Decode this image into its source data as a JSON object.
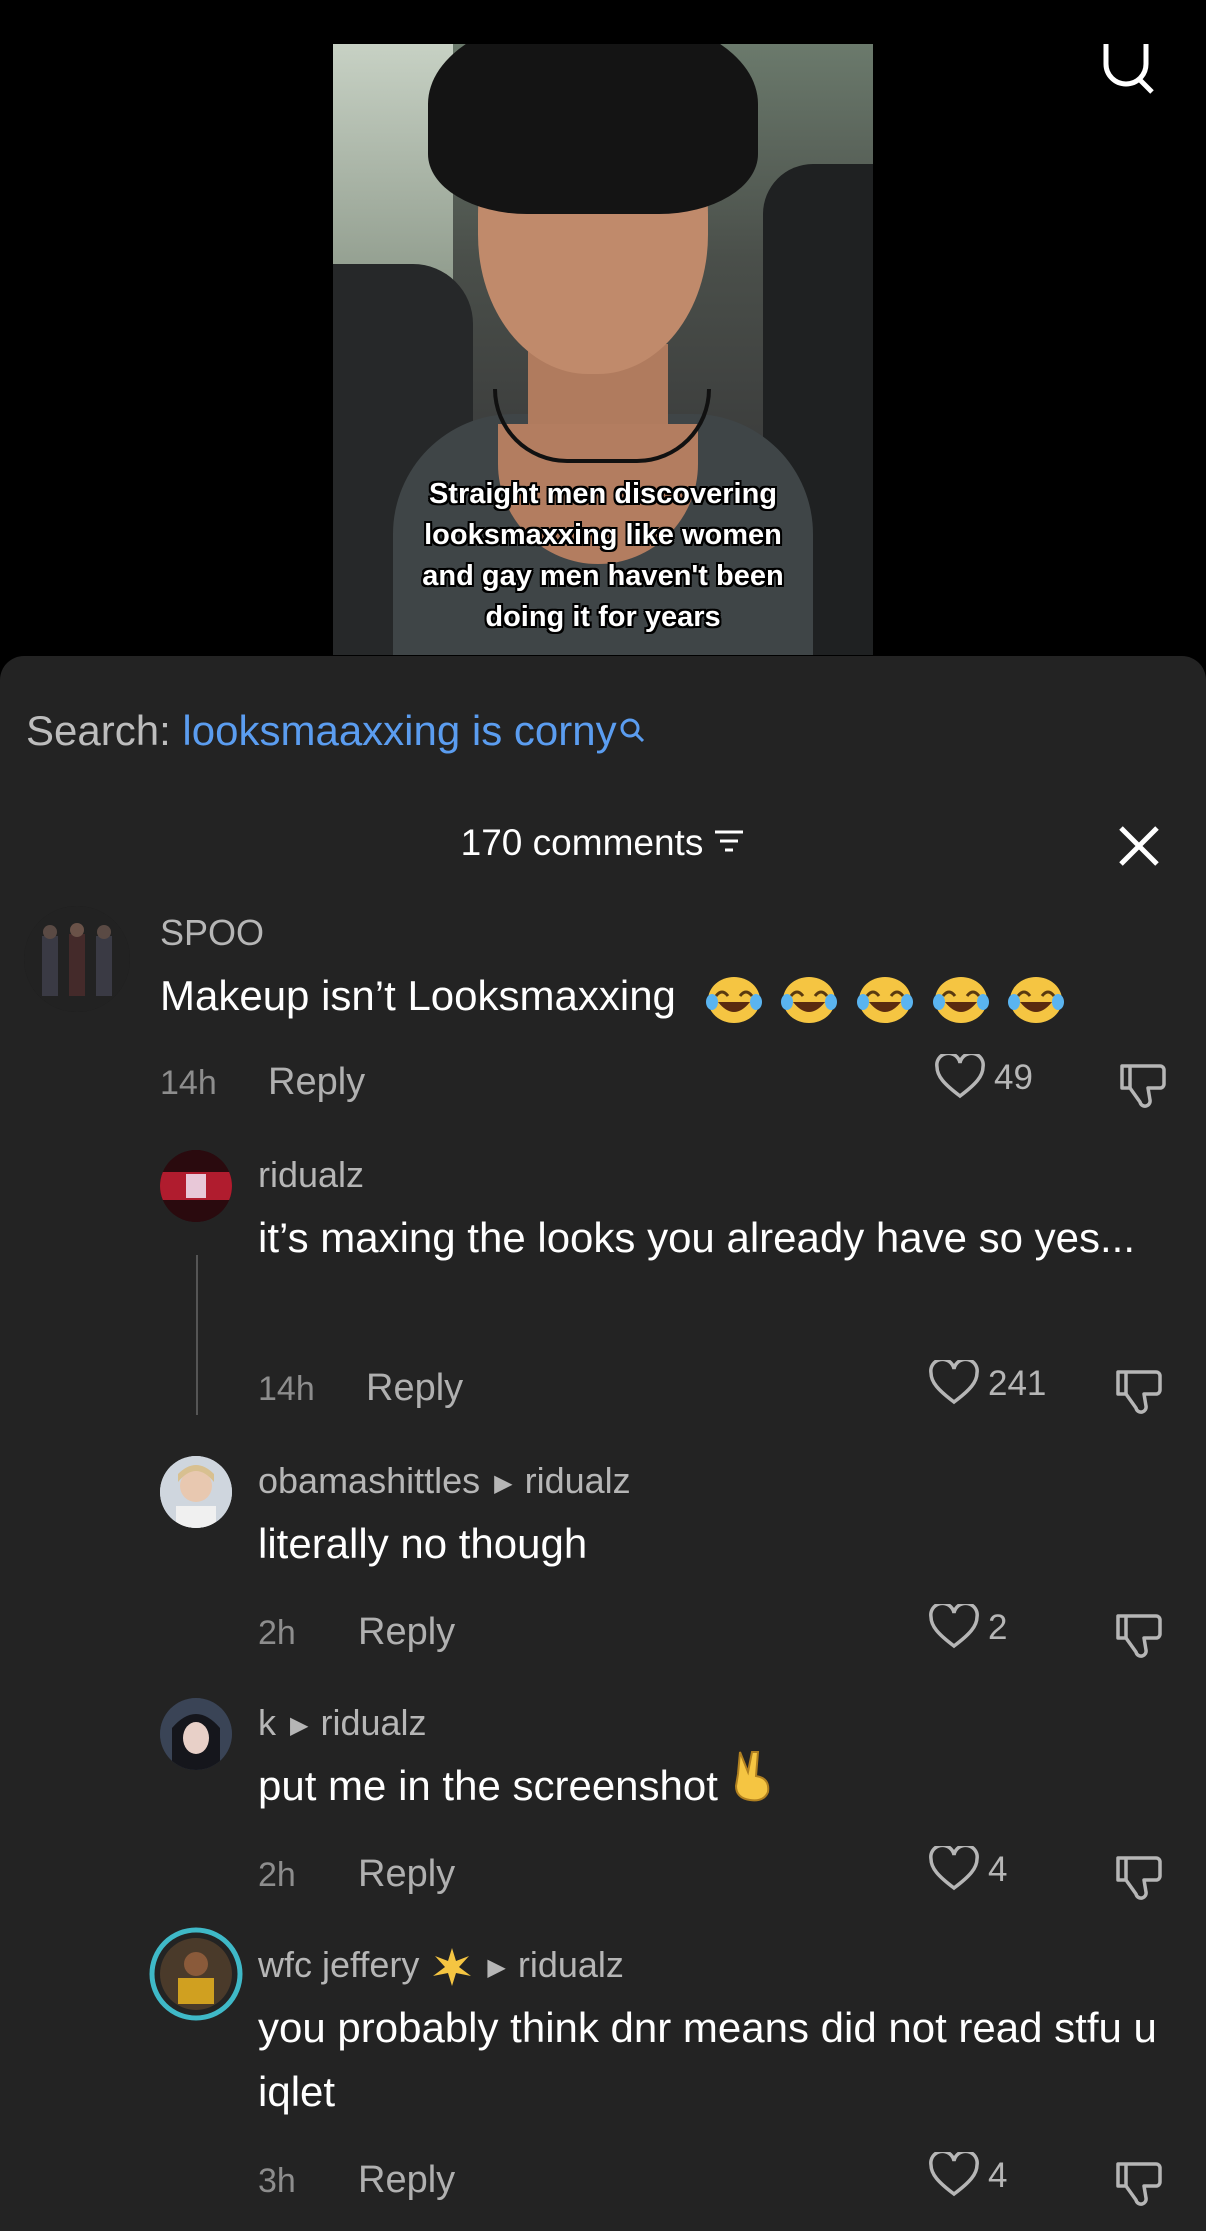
{
  "video": {
    "caption_lines": [
      "Straight men discovering",
      "looksmaxxing like women",
      "and gay men haven't been",
      "doing it for years"
    ]
  },
  "search": {
    "prefix": "Search:",
    "query": "looksmaaxxing is corny"
  },
  "comments_header": {
    "count_label": "170 comments"
  },
  "comments": [
    {
      "username": "SPOO",
      "text": "Makeup isn’t Looksmaxxing",
      "emoji": "😂😂😂😂😂",
      "time": "14h",
      "reply_label": "Reply",
      "likes": "49"
    },
    {
      "username": "ridualz",
      "text": "it’s maxing the looks you already have so yes...",
      "time": "14h",
      "reply_label": "Reply",
      "likes": "241"
    },
    {
      "username": "obamashittles",
      "reply_to": "ridualz",
      "text": "literally no though",
      "time": "2h",
      "reply_label": "Reply",
      "likes": "2"
    },
    {
      "username": "k",
      "reply_to": "ridualz",
      "text": "put me in the screenshot",
      "time": "2h",
      "reply_label": "Reply",
      "likes": "4"
    },
    {
      "username": "wfc jeffery",
      "reply_to": "ridualz",
      "text": "you probably think dnr means did not read stfu u iqlet",
      "time": "3h",
      "reply_label": "Reply",
      "likes": "4"
    }
  ],
  "icons": {
    "top_right": "search-icon",
    "close": "close-icon",
    "filter": "filter-icon",
    "like": "heart-icon",
    "dislike": "thumbs-down-icon",
    "reply_arrow": "play-triangle-icon"
  },
  "colors": {
    "background": "#000000",
    "sheet": "#232323",
    "link_blue": "#5b9df0",
    "muted": "#8d8d8d"
  }
}
